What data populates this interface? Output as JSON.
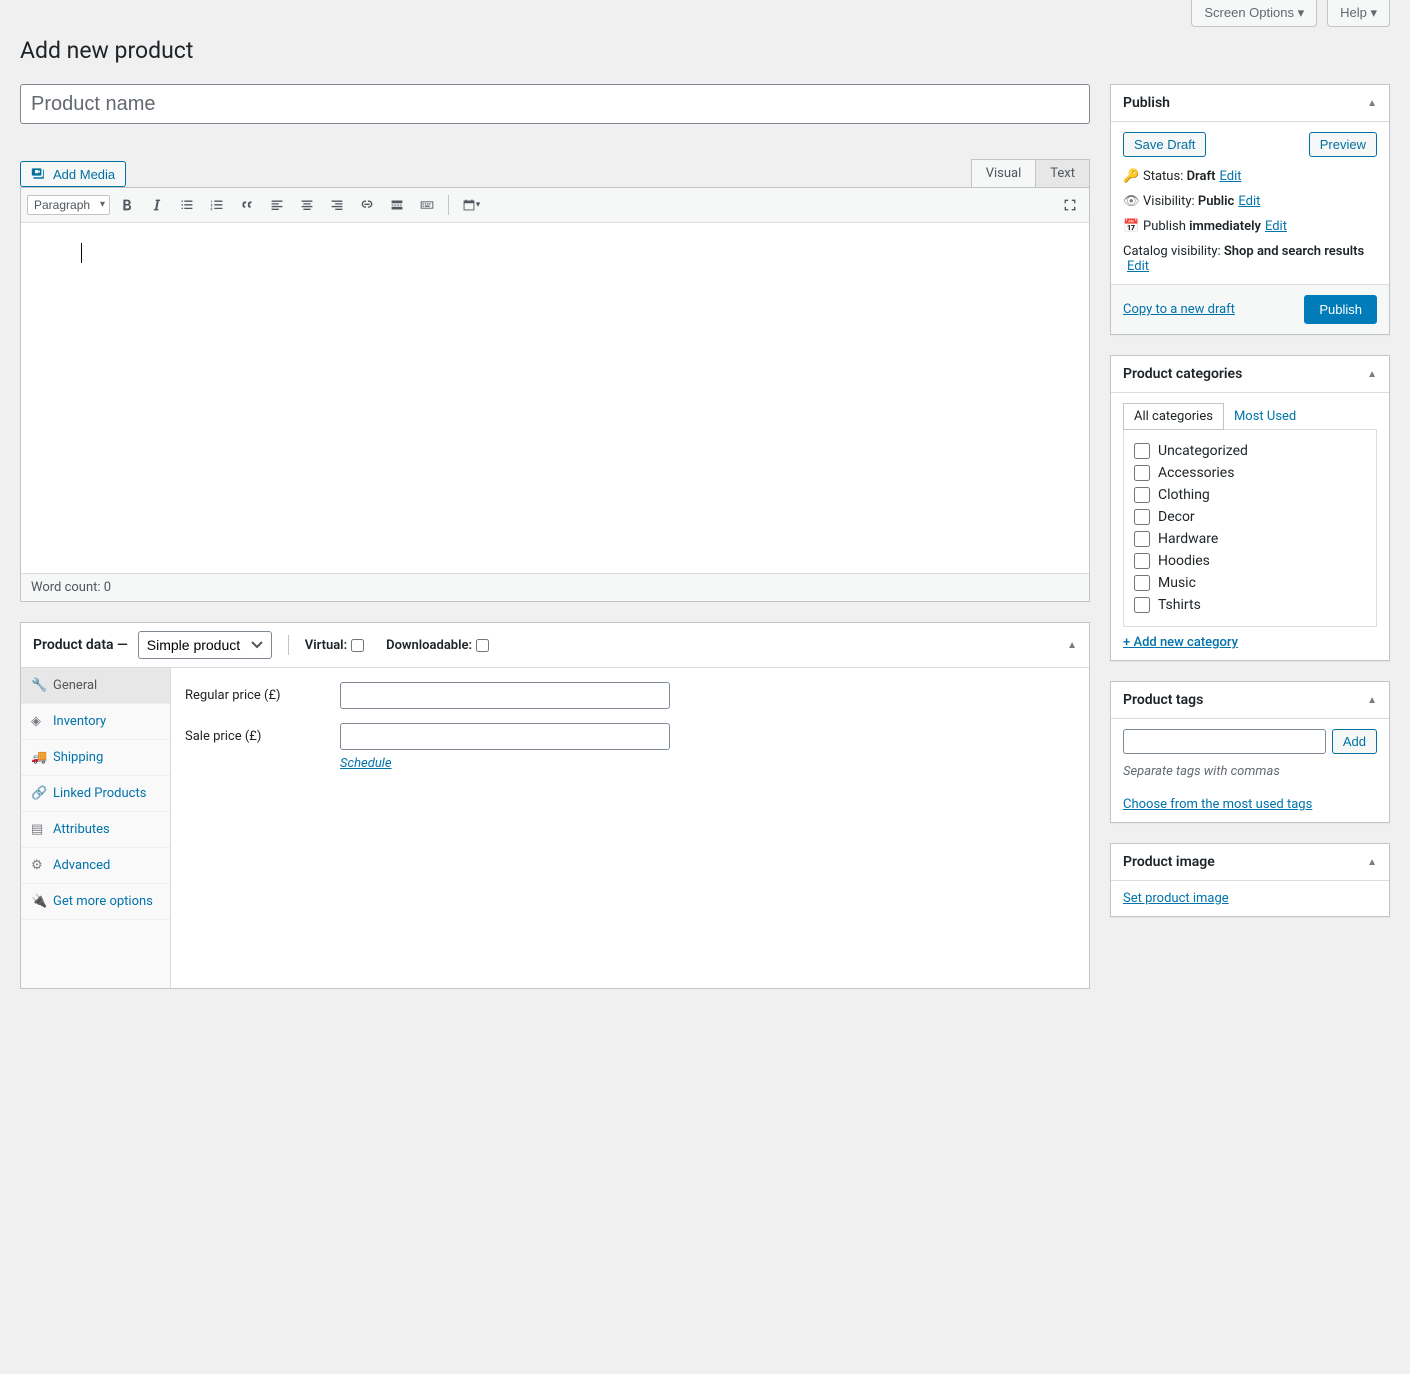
{
  "topbar": {
    "screen_options": "Screen Options",
    "help": "Help"
  },
  "page_title": "Add new product",
  "title_placeholder": "Product name",
  "editor": {
    "add_media": "Add Media",
    "tabs": {
      "visual": "Visual",
      "text": "Text"
    },
    "format": "Paragraph",
    "word_count_label": "Word count:",
    "word_count": "0"
  },
  "product_data": {
    "label": "Product data —",
    "select": "Simple product",
    "virtual": "Virtual:",
    "downloadable": "Downloadable:",
    "tabs": {
      "general": "General",
      "inventory": "Inventory",
      "shipping": "Shipping",
      "linked": "Linked Products",
      "attributes": "Attributes",
      "advanced": "Advanced",
      "get_more": "Get more options"
    },
    "regular_price": "Regular price (£)",
    "sale_price": "Sale price (£)",
    "schedule": "Schedule"
  },
  "publish": {
    "title": "Publish",
    "save_draft": "Save Draft",
    "preview": "Preview",
    "status_label": "Status:",
    "status_value": "Draft",
    "visibility_label": "Visibility:",
    "visibility_value": "Public",
    "publish_label": "Publish",
    "publish_value": "immediately",
    "catalog_label": "Catalog visibility:",
    "catalog_value": "Shop and search results",
    "edit": "Edit",
    "copy": "Copy to a new draft",
    "publish_btn": "Publish"
  },
  "categories": {
    "title": "Product categories",
    "all": "All categories",
    "most_used": "Most Used",
    "items": [
      "Uncategorized",
      "Accessories",
      "Clothing",
      "Decor",
      "Hardware",
      "Hoodies",
      "Music",
      "Tshirts"
    ],
    "add_new": "+ Add new category"
  },
  "tags": {
    "title": "Product tags",
    "add": "Add",
    "hint": "Separate tags with commas",
    "choose": "Choose from the most used tags"
  },
  "image": {
    "title": "Product image",
    "set": "Set product image"
  }
}
